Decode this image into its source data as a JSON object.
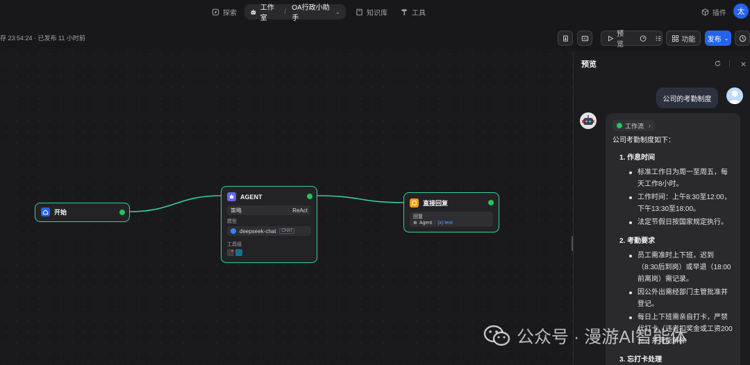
{
  "nav": {
    "explore": "探索",
    "workspace": "工作室",
    "app_name": "OA行政小助手",
    "knowledge": "知识库",
    "tools": "工具",
    "plugins": "插件",
    "avatar_initial": "太"
  },
  "status": {
    "save_text": "存 23:54:24 · 已发布 11 小时前"
  },
  "toolbar": {
    "preview": "预览",
    "function": "功能",
    "publish": "发布"
  },
  "nodes": {
    "start": {
      "title": "开始"
    },
    "agent": {
      "title": "AGENT",
      "strategy_label": "策略",
      "strategy_value": "ReAct",
      "model_label": "模型",
      "model_name": "deepseek-chat",
      "model_tag": "CHAT",
      "tools_label": "工具组"
    },
    "reply": {
      "title": "直接回复",
      "reply_label": "回复",
      "reply_source": "Agent",
      "reply_var": "{x} text"
    }
  },
  "preview": {
    "title": "预览",
    "user_message": "公司的考勤制度",
    "workflow_chip": "工作流",
    "intro": "公司考勤制度如下：",
    "sections": [
      {
        "title": "1. 作息时间",
        "items": [
          "标准工作日为周一至周五，每天工作8小时。",
          "工作时间：上午8:30至12:00，下午13:30至18:00。",
          "法定节假日按国家规定执行。"
        ]
      },
      {
        "title": "2. 考勤要求",
        "items": [
          "员工需准时上下班，迟到（8:30后到岗）或早退（18:00前离岗）需记录。",
          "因公外出需经部门主管批准并登记。",
          "每日上下班需亲自打卡，严禁代打卡（违者扣奖金或工资200元，并可能解除"
        ]
      },
      {
        "title": "3. 忘打卡处理",
        "items": []
      }
    ]
  },
  "watermark": {
    "text": "公众号 · 漫游AI智能体"
  },
  "colors": {
    "accent": "#2563eb",
    "success": "#22c55e",
    "edge": "#34d399",
    "start_icon": "#2563eb",
    "agent_icon": "#6366f1",
    "reply_icon": "#f59e0b"
  }
}
